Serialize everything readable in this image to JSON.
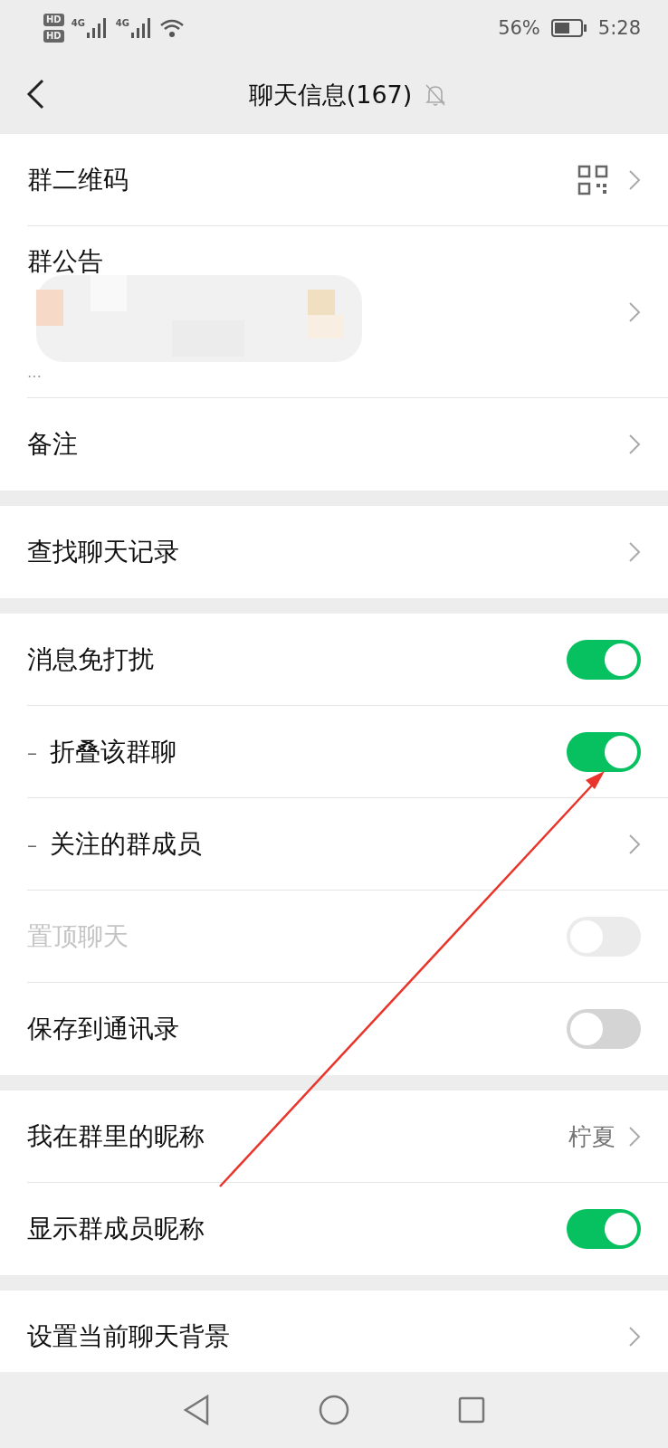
{
  "status_bar": {
    "sim_badges": [
      "HD",
      "HD"
    ],
    "network_labels": [
      "4G",
      "4G"
    ],
    "battery_text": "56%",
    "time": "5:28"
  },
  "header": {
    "title": "聊天信息(167)",
    "muted": true
  },
  "sections": [
    {
      "rows": [
        {
          "kind": "qr",
          "label": "群二维码"
        },
        {
          "kind": "announcement",
          "label": "群公告",
          "more": "…"
        },
        {
          "kind": "chevron",
          "label": "备注"
        }
      ]
    },
    {
      "rows": [
        {
          "kind": "chevron",
          "label": "查找聊天记录"
        }
      ]
    },
    {
      "rows": [
        {
          "kind": "toggle",
          "label": "消息免打扰",
          "on": true,
          "disabled": false
        },
        {
          "kind": "toggle",
          "prefix": "–",
          "label": "折叠该群聊",
          "on": true,
          "disabled": false
        },
        {
          "kind": "chevron",
          "prefix": "–",
          "label": "关注的群成员"
        },
        {
          "kind": "toggle",
          "label": "置顶聊天",
          "on": false,
          "disabled": true
        },
        {
          "kind": "toggle",
          "label": "保存到通讯录",
          "on": false,
          "disabled": false
        }
      ]
    },
    {
      "rows": [
        {
          "kind": "value",
          "label": "我在群里的昵称",
          "value": "柠夏"
        },
        {
          "kind": "toggle",
          "label": "显示群成员昵称",
          "on": true,
          "disabled": false
        }
      ]
    },
    {
      "rows": [
        {
          "kind": "chevron",
          "label": "设置当前聊天背景"
        }
      ]
    }
  ],
  "annotation": {
    "kind": "arrow"
  }
}
